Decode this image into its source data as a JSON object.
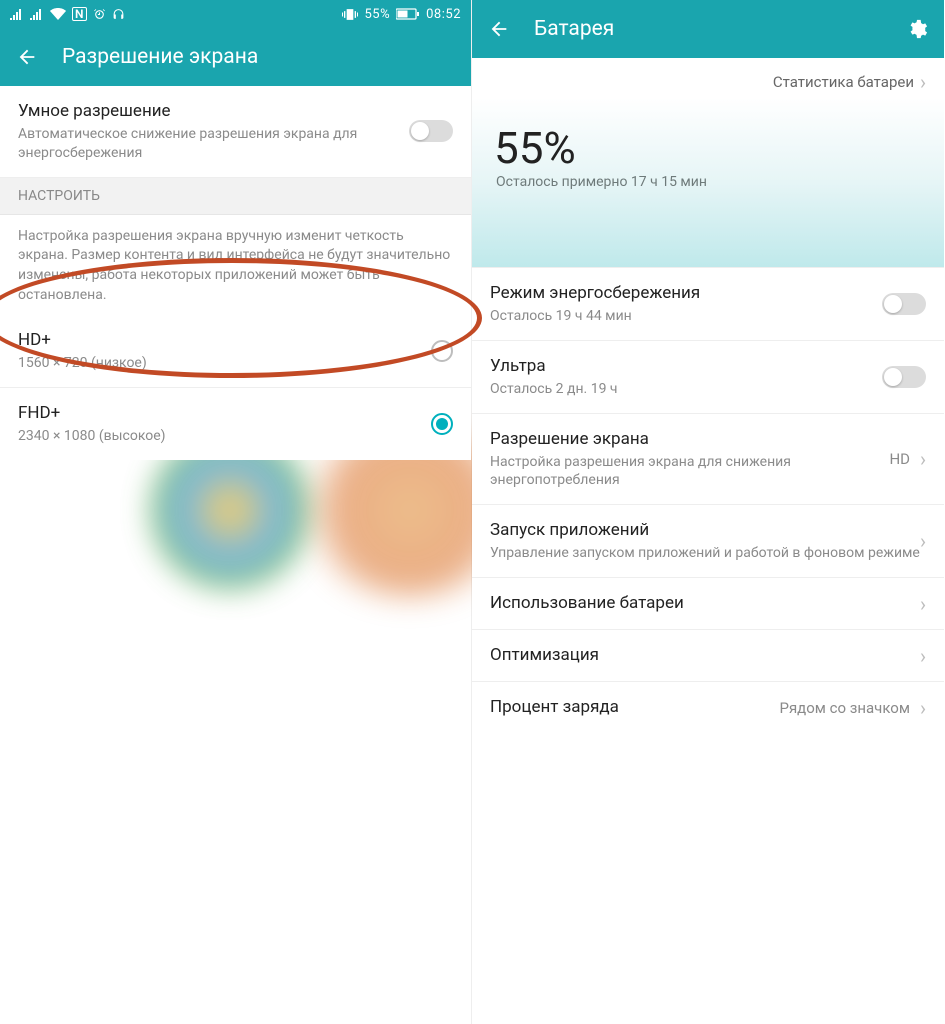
{
  "statusbar": {
    "battery_text": "55%",
    "time": "08:52"
  },
  "left": {
    "title": "Разрешение экрана",
    "smart": {
      "title": "Умное разрешение",
      "sub": "Автоматическое снижение разрешения экрана для энергосбережения"
    },
    "section": "НАСТРОИТЬ",
    "note": "Настройка разрешения экрана вручную изменит четкость экрана. Размер контента и вид интерфейса не будут значительно изменены, работа некоторых приложений может быть остановлена.",
    "opt_hd": {
      "title": "HD+",
      "sub": "1560 × 720 (низкое)"
    },
    "opt_fhd": {
      "title": "FHD+",
      "sub": "2340 × 1080 (высокое)"
    }
  },
  "right": {
    "title": "Батарея",
    "stats_link": "Статистика батареи",
    "percent": "55%",
    "estimate": "Осталось примерно 17 ч 15 мин",
    "row_ps": {
      "title": "Режим энергосбережения",
      "sub": "Осталось 19 ч 44 мин"
    },
    "row_ultra": {
      "title": "Ультра",
      "sub": "Осталось 2 дн. 19 ч"
    },
    "row_res": {
      "title": "Разрешение экрана",
      "sub": "Настройка разрешения экрана для снижения энергопотребления",
      "value": "HD"
    },
    "row_launch": {
      "title": "Запуск приложений",
      "sub": "Управление запуском приложений и работой в фоновом режиме"
    },
    "row_usage": {
      "title": "Использование батареи"
    },
    "row_opt": {
      "title": "Оптимизация"
    },
    "row_charge": {
      "title": "Процент заряда",
      "value": "Рядом со значком"
    }
  }
}
